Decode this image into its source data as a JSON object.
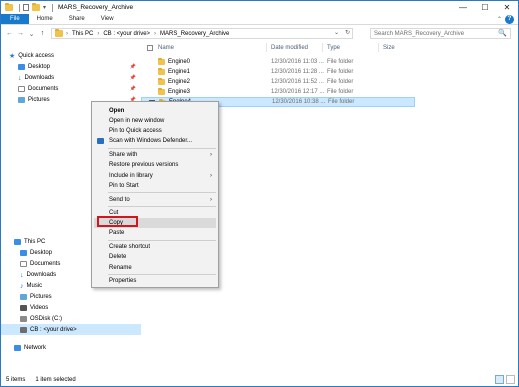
{
  "window": {
    "title": "MARS_Recovery_Archive",
    "controls": {
      "minimize": "—",
      "maximize": "☐",
      "close": "✕"
    }
  },
  "ribbon": {
    "tabs": [
      "File",
      "Home",
      "Share",
      "View"
    ],
    "help_icon": "?",
    "collapse_icon": "chevron-up-icon"
  },
  "address": {
    "back": "←",
    "forward": "→",
    "recent": "⌄",
    "up": "↑",
    "crumbs": [
      "This PC",
      "CB : <your drive>",
      "MARS_Recovery_Archive"
    ],
    "sep": "›",
    "dropdown": "⌄",
    "refresh": "↻"
  },
  "search": {
    "placeholder": "Search MARS_Recovery_Archive",
    "icon": "🔍"
  },
  "nav": {
    "quick_access": "Quick access",
    "pin": "📌",
    "quick_items": [
      "Desktop",
      "Downloads",
      "Documents",
      "Pictures"
    ],
    "this_pc": "This PC",
    "pc_items": [
      "Desktop",
      "Documents",
      "Downloads",
      "Music",
      "Pictures",
      "Videos",
      "OSDisk (C:)",
      "CB : <your drive>"
    ],
    "network": "Network"
  },
  "columns": {
    "name": "Name",
    "date": "Date modified",
    "type": "Type",
    "size": "Size"
  },
  "files": [
    {
      "name": "Engine0",
      "date": "12/30/2016 11:03 ...",
      "type": "File folder"
    },
    {
      "name": "Engine1",
      "date": "12/30/2016 11:28 ...",
      "type": "File folder"
    },
    {
      "name": "Engine2",
      "date": "12/30/2016 11:52 ...",
      "type": "File folder"
    },
    {
      "name": "Engine3",
      "date": "12/30/2016 12:17 ...",
      "type": "File folder"
    },
    {
      "name": "Engine4",
      "date": "12/30/2016 10:38 ...",
      "type": "File folder"
    }
  ],
  "selected_index": 4,
  "checkmark": "✓",
  "context_menu": {
    "items": [
      "Open",
      "Open in new window",
      "Pin to Quick access",
      "Scan with Windows Defender...",
      "Share with",
      "Restore previous versions",
      "Include in library",
      "Pin to Start",
      "Send to",
      "Cut",
      "Copy",
      "Paste",
      "Create shortcut",
      "Delete",
      "Rename",
      "Properties"
    ],
    "arrow": "›"
  },
  "status": {
    "count": "5 items",
    "selection": "1 item selected"
  },
  "colors": {
    "accent": "#1979ca",
    "selection": "#cce8ff",
    "highlight_box": "#d0161f"
  }
}
